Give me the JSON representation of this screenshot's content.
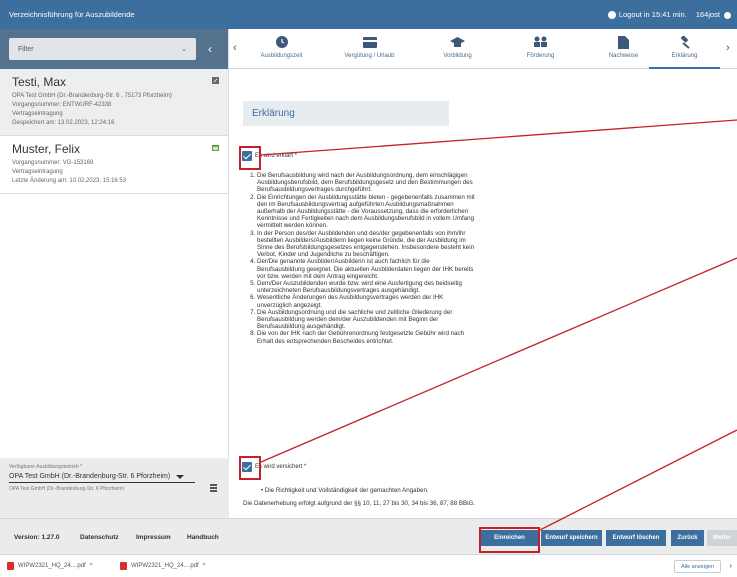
{
  "app": {
    "title": "Verzeichnisführung für Auszubildende",
    "logout": "Logout in 15:41 min.",
    "user": "164jost"
  },
  "sidebar": {
    "filter": "Filter",
    "cards": [
      {
        "name": "Testi, Max",
        "lines": [
          "OPA Test GmbH (Dr.-Brandenburg-Str. 6 , 75173 Pforzheim)",
          "Vorgangsnummer: ENTWURF-42338",
          "Vertragseintragung",
          "Gespeichert am: 13.02.2023, 12:24:16"
        ]
      },
      {
        "name": "Muster, Felix",
        "lines": [
          "Vorgangsnummer: VG-153169",
          "Vertragseintragung",
          "Letzte Änderung am: 10.02.2023, 15:16:53"
        ]
      }
    ],
    "betrieb_label": "Verfügbarer Ausbildungsbetrieb *",
    "betrieb_value": "OPA Test GmbH (Dr.-Brandenburg-Str. 6 Pforzheim)",
    "betrieb_sub": "OPA Test GmbH (Dr.-Brandenburg-Str. 6 Pforzheim)"
  },
  "tabs": [
    "Ausbildungszeit",
    "Vergütung / Urlaub",
    "Vorbildung",
    "Förderung",
    "Nachweise",
    "Erklärung"
  ],
  "content": {
    "heading": "Erklärung",
    "check1_label": "Es wird erklärt *",
    "items": [
      "Die Berufsausbildung wird nach der Ausbildungsordnung, dem einschlägigen Ausbildungsberufsbild, dem Berufsbildungsgesetz und den Bestimmungen des Berufsausbildungsvertrages durchgeführt.",
      "Die Einrichtungen der Ausbildungsstätte bieten - gegebenenfalls zusammen mit den im Berufsausbildungsvertrag aufgeführten Ausbildungsmaßnahmen außerhalb der Ausbildungsstätte - die Voraussetzung, dass die erforderlichen Kenntnisse und Fertigkeiten nach dem Ausbildungsberufsbild in vollem Umfang vermittelt werden können.",
      "In der Person des/der Ausbildenden und des/der gegebenenfalls von ihm/ihr bestellten Ausbilders/Ausbilderin liegen keine Gründe, die der Ausbildung im Sinne des Berufsbildungsgesetzes entgegenstehen. Insbesondere besteht kein Verbot, Kinder und Jugendliche zu beschäftigen.",
      "Der/Die genannte Ausbilder/Ausbilderin ist auch fachlich für die Berufsausbildung geeignet. Die aktuellen Ausbilderdaten liegen der IHK bereits vor bzw. werden mit dem Antrag eingereicht.",
      "Dem/Der Auszubildenden wurde bzw. wird eine Ausfertigung des beidseitig unterzeichneten Berufsausbildungsvertrages ausgehändigt.",
      "Wesentliche Änderungen des Ausbildungsvertrages werden der IHK unverzüglich angezeigt.",
      "Die Ausbildungsordnung und die sachliche und zeitliche Gliederung der Berufsausbildung werden dem/der Auszubildenden mit Beginn der Berufsausbildung ausgehändigt.",
      "Die von der IHK nach der Gebührenordnung festgesetzte Gebühr wird nach Erhalt des entsprechenden Bescheides entrichtet."
    ],
    "check2_label": "Es wird versichert *",
    "bullet": "Die Richtigkeit und Vollständigkeit der gemachten Angaben.",
    "datenerhebung": "Die Datenerhebung erfolgt aufgrund der §§ 10, 11, 27 bis 30, 34 bis 36, 87, 88 BBiG."
  },
  "footer": {
    "version": "Version: 1.27.0",
    "datenschutz": "Datenschutz",
    "impressum": "Impressum",
    "handbuch": "Handbuch",
    "buttons": [
      "Einreichen",
      "Entwurf speichern",
      "Entwurf löschen",
      "Zurück",
      "Weiter"
    ]
  },
  "downloads": {
    "files": [
      "WIPW2321_HQ_24....pdf",
      "WIPW2321_HQ_24....pdf"
    ],
    "show_all": "Alle anzeigen"
  },
  "colors": {
    "brand": "#3c6e9e",
    "annotation": "#c8202a"
  },
  "icons": [
    "clock-icon",
    "user-icon",
    "edit-icon",
    "calendar-icon",
    "clock-tab-icon",
    "card-icon",
    "graduation-cap-icon",
    "people-icon",
    "document-icon",
    "gavel-icon",
    "pdf-icon"
  ]
}
